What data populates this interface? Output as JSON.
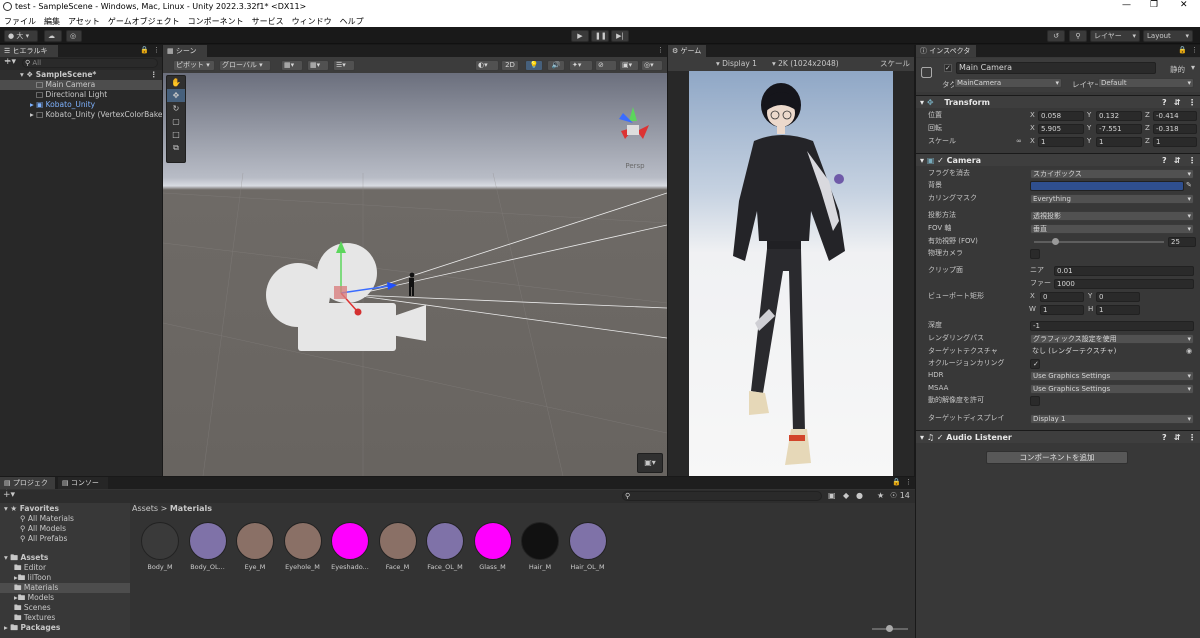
{
  "window": {
    "title": "test - SampleScene - Windows, Mac, Linux - Unity 2022.3.32f1* <DX11>"
  },
  "menu": [
    "ファイル",
    "編集",
    "アセット",
    "ゲームオブジェクト",
    "コンポーネント",
    "サービス",
    "ウィンドウ",
    "ヘルプ"
  ],
  "toolbar": {
    "account_label": "大",
    "layers_label": "レイヤー",
    "layout_label": "Layout"
  },
  "hierarchy": {
    "tab_label": "ヒエラルキー",
    "search_placeholder": "All",
    "items": [
      {
        "label": "SampleScene*"
      },
      {
        "label": "Main Camera"
      },
      {
        "label": "Directional Light"
      },
      {
        "label": "Kobato_Unity"
      },
      {
        "label": "Kobato_Unity (VertexColorBake"
      }
    ]
  },
  "scene": {
    "tab_label": "シーン",
    "pivot_label": "ピボット",
    "global_label": "グローバル",
    "mode_2d": "2D",
    "persp_label": "Persp"
  },
  "game": {
    "tab_label": "ゲーム",
    "display_label": "Display 1",
    "resolution_label": "2K (1024x2048)",
    "scale_label": "スケール"
  },
  "inspector": {
    "tab_label": "インスペクター",
    "object_name": "Main Camera",
    "static_label": "静的",
    "tag_label": "タグ",
    "tag_value": "MainCamera",
    "layer_label": "レイヤー",
    "layer_value": "Default",
    "transform": {
      "title": "Transform",
      "position_label": "位置",
      "rotation_label": "回転",
      "scale_label": "スケール",
      "position": {
        "x": "0.058",
        "y": "0.132",
        "z": "-0.414"
      },
      "rotation": {
        "x": "5.905",
        "y": "-7.551",
        "z": "-0.318"
      },
      "scale": {
        "x": "1",
        "y": "1",
        "z": "1"
      }
    },
    "camera": {
      "title": "Camera",
      "clear_flags_label": "フラグを消去",
      "clear_flags_value": "スカイボックス",
      "background_label": "背景",
      "background_color": "#2f4f8f",
      "culling_mask_label": "カリングマスク",
      "culling_mask_value": "Everything",
      "projection_label": "投影方法",
      "projection_value": "透視投影",
      "fov_axis_label": "FOV 軸",
      "fov_axis_value": "垂直",
      "fov_label": "有効視野 (FOV)",
      "fov_value": "25",
      "fov_fraction": 0.14,
      "physical_label": "物理カメラ",
      "clip_label": "クリップ面",
      "near_label": "ニア",
      "near_value": "0.01",
      "far_label": "ファー",
      "far_value": "1000",
      "viewport_label": "ビューポート矩形",
      "vp_x": "0",
      "vp_y": "0",
      "vp_w": "1",
      "vp_h": "1",
      "depth_label": "深度",
      "depth_value": "-1",
      "render_path_label": "レンダリングパス",
      "render_path_value": "グラフィックス設定を使用",
      "target_tex_label": "ターゲットテクスチャ",
      "target_tex_value": "なし (レンダーテクスチャ)",
      "occlusion_label": "オクルージョンカリング",
      "hdr_label": "HDR",
      "hdr_value": "Use Graphics Settings",
      "msaa_label": "MSAA",
      "msaa_value": "Use Graphics Settings",
      "dynres_label": "動的解像度を許可",
      "target_display_label": "ターゲットディスプレイ",
      "target_display_value": "Display 1"
    },
    "audio": {
      "title": "Audio Listener"
    },
    "add_component_label": "コンポーネントを追加"
  },
  "project": {
    "tab_label": "プロジェクト",
    "console_tab_label": "コンソール",
    "breadcrumb_root": "Assets",
    "breadcrumb_current": "Materials",
    "hidden_count": "14",
    "favorites_label": "Favorites",
    "favorites": [
      "All Materials",
      "All Models",
      "All Prefabs"
    ],
    "assets_label": "Assets",
    "folders": [
      "Editor",
      "lilToon",
      "Materials",
      "Models",
      "Scenes",
      "Textures"
    ],
    "packages_label": "Packages",
    "assets": [
      {
        "name": "Body_M",
        "color": "#3a3a3a"
      },
      {
        "name": "Body_OL...",
        "color": "#7f72a8"
      },
      {
        "name": "Eye_M",
        "color": "#8a7066"
      },
      {
        "name": "Eyehole_M",
        "color": "#8a7066"
      },
      {
        "name": "Eyeshado...",
        "color": "#ff00ff"
      },
      {
        "name": "Face_M",
        "color": "#8a7066"
      },
      {
        "name": "Face_OL_M",
        "color": "#7f72a8"
      },
      {
        "name": "Glass_M",
        "color": "#ff00ff"
      },
      {
        "name": "Hair_M",
        "color": "#111111"
      },
      {
        "name": "Hair_OL_M",
        "color": "#7f72a8"
      }
    ]
  }
}
